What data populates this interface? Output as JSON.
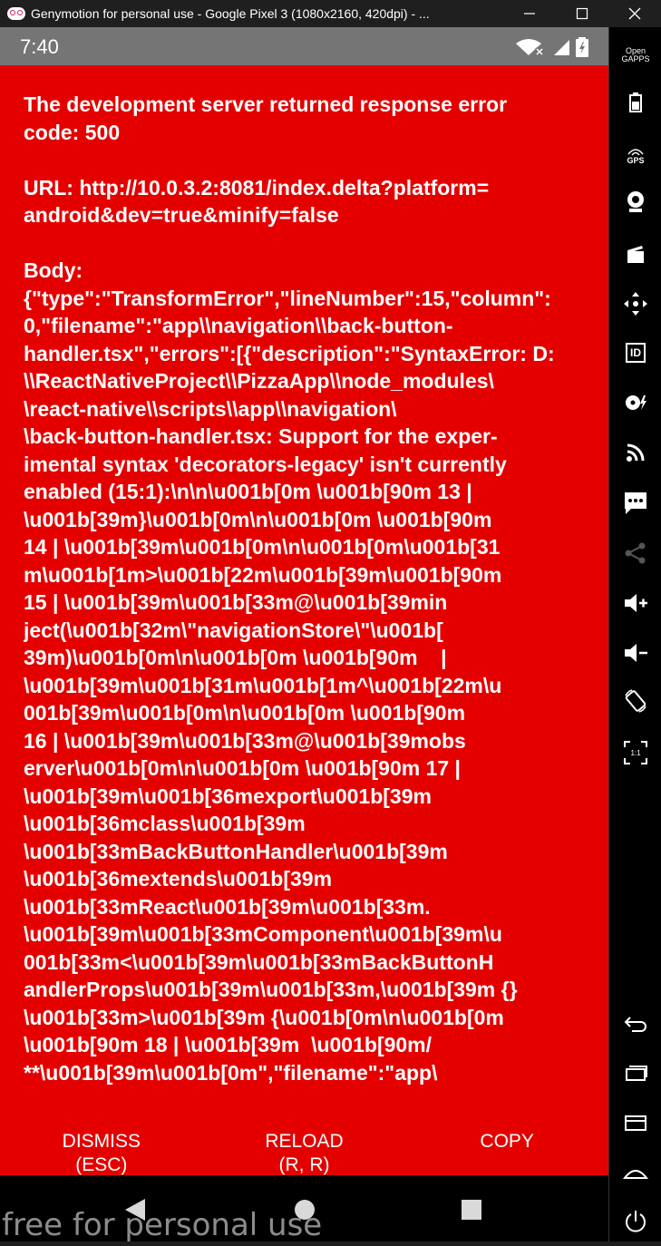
{
  "window": {
    "title": "Genymotion for personal use - Google Pixel 3 (1080x2160, 420dpi) - ...",
    "minimize_icon": "minimize-icon",
    "maximize_icon": "maximize-icon",
    "close_icon": "close-icon"
  },
  "statusbar": {
    "time": "7:40"
  },
  "error": {
    "heading_lines": [
      "The development server returned response error",
      "code: 500"
    ],
    "url_lines": [
      "URL: http://10.0.3.2:8081/index.delta?platform=",
      "android&dev=true&minify=false"
    ],
    "body_lines": [
      "Body:",
      "{\"type\":\"TransformError\",\"lineNumber\":15,\"column\":",
      "0,\"filename\":\"app\\\\navigation\\\\back-button-",
      "handler.tsx\",\"errors\":[{\"description\":\"SyntaxError: D:",
      "\\\\ReactNativeProject\\\\PizzaApp\\\\node_modules\\",
      "\\react-native\\\\scripts\\\\app\\\\navigation\\",
      "\\back-button-handler.tsx: Support for the exper-",
      "imental syntax 'decorators-legacy' isn't currently",
      "enabled (15:1):\\n\\n\\u001b[0m \\u001b[90m 13 |",
      "\\u001b[39m}\\u001b[0m\\n\\u001b[0m \\u001b[90m",
      "14 | \\u001b[39m\\u001b[0m\\n\\u001b[0m\\u001b[31",
      "m\\u001b[1m>\\u001b[22m\\u001b[39m\\u001b[90m",
      "15 | \\u001b[39m\\u001b[33m@\\u001b[39min",
      "ject(\\u001b[32m\\\"navigationStore\\\"\\u001b[",
      "39m)\\u001b[0m\\n\\u001b[0m \\u001b[90m    |",
      "\\u001b[39m\\u001b[31m\\u001b[1m^\\u001b[22m\\u",
      "001b[39m\\u001b[0m\\n\\u001b[0m \\u001b[90m",
      "16 | \\u001b[39m\\u001b[33m@\\u001b[39mobs",
      "erver\\u001b[0m\\n\\u001b[0m \\u001b[90m 17 |",
      "\\u001b[39m\\u001b[36mexport\\u001b[39m",
      "\\u001b[36mclass\\u001b[39m",
      "\\u001b[33mBackButtonHandler\\u001b[39m",
      "\\u001b[36mextends\\u001b[39m",
      "\\u001b[33mReact\\u001b[39m\\u001b[33m.",
      "\\u001b[39m\\u001b[33mComponent\\u001b[39m\\u",
      "001b[33m<\\u001b[39m\\u001b[33mBackButtonH",
      "andlerProps\\u001b[39m\\u001b[33m,\\u001b[39m {}",
      "\\u001b[33m>\\u001b[39m {\\u001b[0m\\n\\u001b[0m",
      "\\u001b[90m 18 | \\u001b[39m  \\u001b[90m/",
      "**\\u001b[39m\\u001b[0m\",\"filename\":\"app\\"
    ]
  },
  "actions": {
    "dismiss": "DISMISS",
    "dismiss_hint": "(ESC)",
    "reload": "RELOAD",
    "reload_hint": "(R, R)",
    "copy": "COPY"
  },
  "watermark": "free for personal use",
  "sidebar": {
    "gapps": "Open\nGAPPS",
    "gps": "GPS",
    "id": "ID",
    "scale": "1:1"
  },
  "colors": {
    "error_red": "#e50000",
    "statusbar": "#757575",
    "titlebar": "#1f1f1f"
  }
}
